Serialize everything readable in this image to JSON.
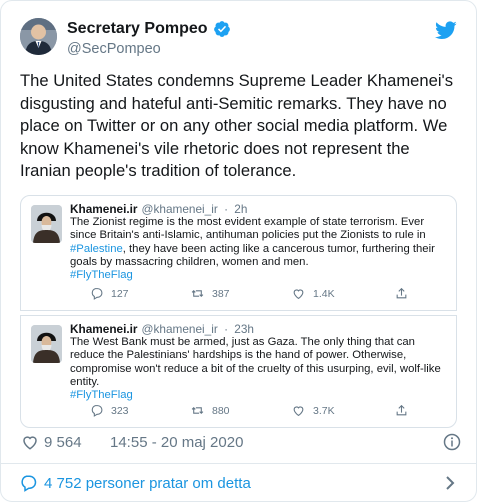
{
  "tweet": {
    "name": "Secretary Pompeo",
    "handle": "@SecPompeo",
    "text": "The United States condemns Supreme Leader Khamenei's disgusting and hateful anti-Semitic remarks. They have no place on Twitter or on any other social media platform. We know Khamenei's vile rhetoric does not represent the Iranian people's tradition of tolerance."
  },
  "quotes": [
    {
      "name": "Khamenei.ir",
      "handle": "@khamenei_ir",
      "sep": "·",
      "time": "2h",
      "body_before": "The Zionist regime is the most evident example of state terrorism. Ever since Britain's anti-Islamic, antihuman policies put the Zionists to rule in ",
      "body_link": "#Palestine",
      "body_after": ", they have been acting like a cancerous tumor, furthering their goals by massacring children, women and men.",
      "hashtag": "#FlyTheFlag",
      "replies": "127",
      "retweets": "387",
      "likes": "1.4K"
    },
    {
      "name": "Khamenei.ir",
      "handle": "@khamenei_ir",
      "sep": "·",
      "time": "23h",
      "body_before": "The West Bank must be armed, just as Gaza. The only thing that can reduce the Palestinians' hardships is the hand of power. Otherwise, compromise won't reduce a bit of the cruelty of this usurping, evil, wolf-like entity.",
      "body_link": "",
      "body_after": "",
      "hashtag": "#FlyTheFlag",
      "replies": "323",
      "retweets": "880",
      "likes": "3.7K"
    }
  ],
  "stats": {
    "likes": "9 564",
    "timestamp": "14:55 - 20 maj 2020"
  },
  "footer": {
    "talking": "4 752 personer pratar om detta"
  },
  "icons": {
    "brand": "twitter-bird-icon",
    "verified": "verified-badge-icon",
    "reply": "reply-icon",
    "retweet": "retweet-icon",
    "like": "heart-icon",
    "share": "share-icon",
    "info": "info-icon",
    "comment": "comment-bubble-icon",
    "chevron": "chevron-right-icon"
  },
  "colors": {
    "accent": "#1da1f2",
    "link": "#1b95e0",
    "text": "#14171a",
    "secondary": "#657786",
    "border": "#e1e8ed"
  }
}
